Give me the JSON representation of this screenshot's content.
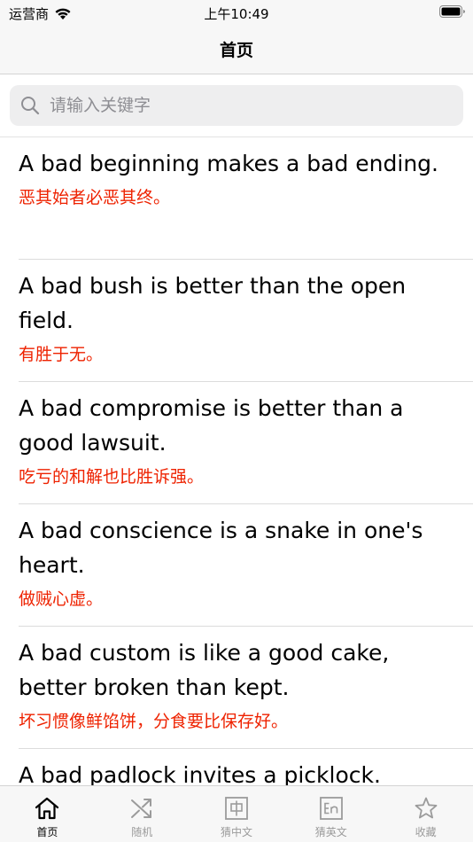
{
  "status_bar": {
    "carrier": "运营商",
    "time": "上午10:49"
  },
  "nav": {
    "title": "首页"
  },
  "search": {
    "placeholder": "请输入关键字",
    "value": ""
  },
  "proverbs": [
    {
      "en": "A bad beginning makes a bad ending.",
      "cn": "恶其始者必恶其终。"
    },
    {
      "en": "A bad bush is better than the open field.",
      "cn": "有胜于无。"
    },
    {
      "en": "A bad compromise is better than a good lawsuit.",
      "cn": "吃亏的和解也比胜诉强。"
    },
    {
      "en": "A bad conscience is a snake in one's heart.",
      "cn": "做贼心虚。"
    },
    {
      "en": "A bad custom is like a good cake, better broken than kept.",
      "cn": "坏习惯像鲜馅饼，分食要比保存好。"
    },
    {
      "en": "A bad padlock invites a picklock.",
      "cn": ""
    }
  ],
  "tab_bar": {
    "tabs": [
      {
        "label": "首页",
        "icon": "home-icon",
        "active": true
      },
      {
        "label": "随机",
        "icon": "shuffle-icon",
        "active": false
      },
      {
        "label": "猜中文",
        "icon": "chinese-char-icon",
        "active": false
      },
      {
        "label": "猜英文",
        "icon": "english-en-icon",
        "active": false
      },
      {
        "label": "收藏",
        "icon": "star-icon",
        "active": false
      }
    ]
  },
  "colors": {
    "accent_red": "#ee2200",
    "inactive_gray": "#9b9b9b",
    "bar_background": "#f7f7f7"
  }
}
